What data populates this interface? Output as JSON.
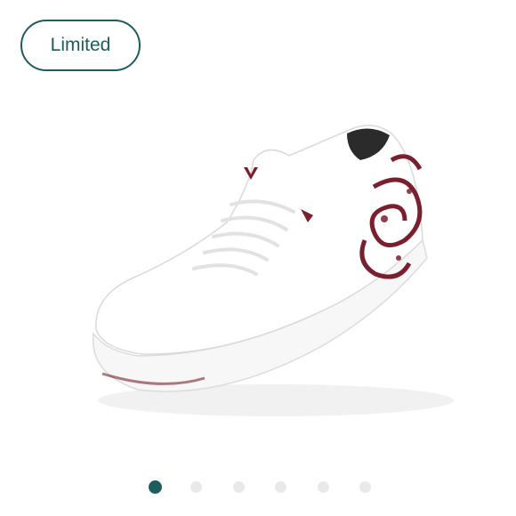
{
  "badge": {
    "label": "Limited"
  },
  "gallery": {
    "image_icon": "white-knit-sneaker-with-maroon-embroidery",
    "slide_count": 6,
    "active_slide": 1
  },
  "colors": {
    "accent": "#1f5c5c",
    "dot_inactive": "#e8eaea",
    "embroidery": "#7a1f2e"
  }
}
